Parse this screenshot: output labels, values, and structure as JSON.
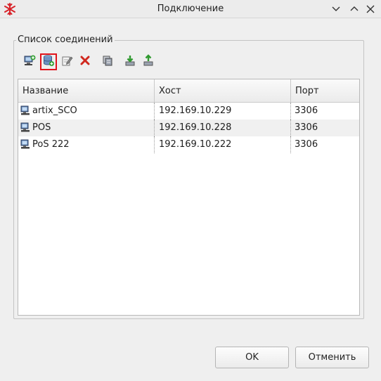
{
  "window": {
    "title": "Подключение",
    "app_icon": "snowflake-app-icon"
  },
  "group": {
    "title": "Список соединений"
  },
  "toolbar": {
    "tools": [
      {
        "name": "add-connection",
        "icon": "computer-add-icon"
      },
      {
        "name": "add-database",
        "icon": "database-add-icon",
        "selected": true
      },
      {
        "name": "edit",
        "icon": "edit-icon"
      },
      {
        "name": "delete",
        "icon": "delete-icon"
      },
      {
        "name": "copy",
        "icon": "copy-icon"
      },
      {
        "name": "import",
        "icon": "import-icon"
      },
      {
        "name": "export",
        "icon": "export-icon"
      }
    ]
  },
  "table": {
    "columns": [
      "Название",
      "Хост",
      "Порт"
    ],
    "rows": [
      {
        "name": "artix_SCO",
        "host": "192.169.10.229",
        "port": "3306"
      },
      {
        "name": "POS",
        "host": "192.169.10.228",
        "port": "3306"
      },
      {
        "name": "PoS 222",
        "host": "192.169.10.222",
        "port": "3306"
      }
    ]
  },
  "buttons": {
    "ok": "OK",
    "cancel": "Отменить"
  },
  "colors": {
    "selection_outline": "#e0141c",
    "background": "#efefef"
  }
}
